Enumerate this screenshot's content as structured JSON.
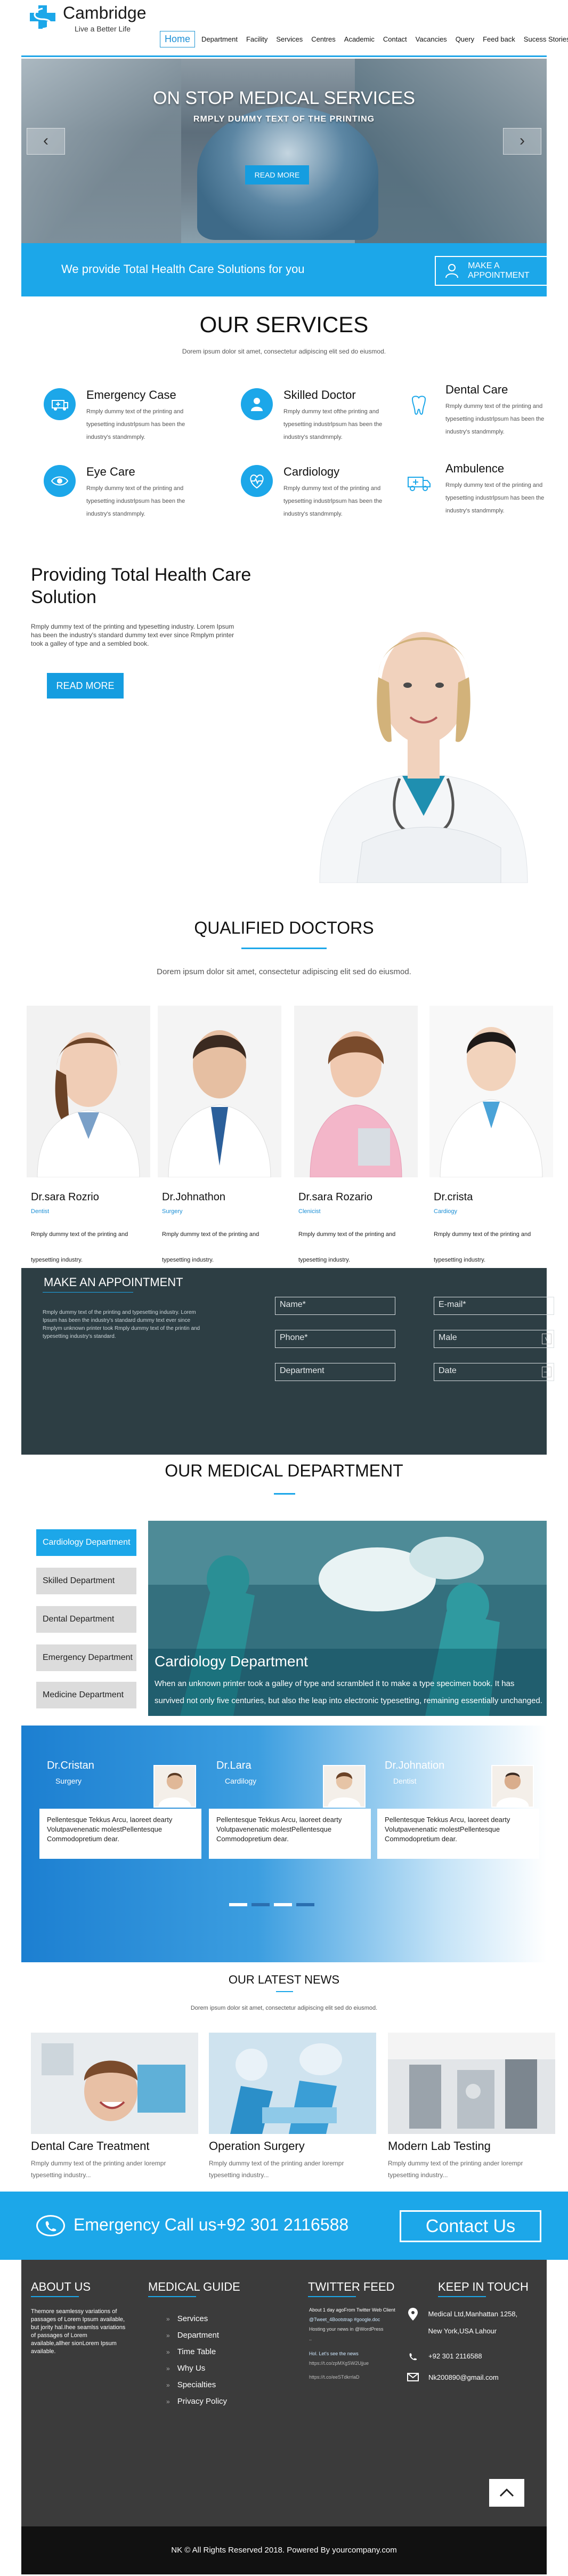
{
  "brand": {
    "name": "Cambridge",
    "tagline": "Live a Better Life",
    "color": "#1ca7e9"
  },
  "nav": [
    "Home",
    "Department",
    "Facility",
    "Services",
    "Centres",
    "Academic",
    "Contact",
    "Vacancies",
    "Query",
    "Feed back",
    "Sucess Stories"
  ],
  "hero": {
    "title": "ON STOP MEDICAL SERVICES",
    "subtitle": "RMPLY DUMMY TEXT OF THE PRINTING",
    "button": "READ MORE",
    "prev_icon": "arrow-left-icon",
    "next_icon": "arrow-right-icon"
  },
  "strip": {
    "text": "We provide Total Health Care Solutions for you",
    "button": "MAKE A APPOINTMENT"
  },
  "services": {
    "title": "OUR SERVICES",
    "subtitle": "Dorem ipsum dolor sit amet, consectetur adipiscing elit sed do eiusmod.",
    "items": [
      {
        "name": "Emergency Case",
        "desc": "Rmply dummy text of the printing and typesetting industrlpsum has been the industry's standmmply.",
        "icon": "ambulance-icon"
      },
      {
        "name": "Skilled Doctor",
        "desc": "Rmply dummy text ofthe printing and typesetting industrlpsum has been the industry's standmmply.",
        "icon": "doctor-icon"
      },
      {
        "name": "Dental Care",
        "desc": "Rmply dummy text of the printing and typesetting industrlpsum has been the industry's standmmply.",
        "icon": "tooth-icon"
      },
      {
        "name": "Eye Care",
        "desc": "Rmply dummy text of the printing and typesetting industrlpsum has been the industry's standmmply.",
        "icon": "eye-icon"
      },
      {
        "name": "Cardiology",
        "desc": "Rmply dummy text of the printing and typesetting industrlpsum has been the industry's standmmply.",
        "icon": "heart-icon"
      },
      {
        "name": "Ambulence",
        "desc": "Rmply dummy text of the printing and typesetting industrlpsum has been the industry's standmmply.",
        "icon": "ambulance-van-icon"
      }
    ]
  },
  "providing": {
    "title": "Providing Total Health Care Solution",
    "text": "Rmply dummy text of the printing and typesetting industry. Lorem Ipsum has been the industry's standard dummy text ever since Rmplym printer took a galley of type and a sembled book.",
    "button": "READ MORE"
  },
  "doctors": {
    "title": "QUALIFIED DOCTORS",
    "subtitle": "Dorem ipsum dolor sit amet, consectetur adipiscing elit sed do eiusmod.",
    "items": [
      {
        "name": "Dr.sara Rozrio",
        "role": "Dentist",
        "desc": "Rmply dummy text of the printing and typesetting industry."
      },
      {
        "name": "Dr.Johnathon",
        "role": "Surgery",
        "desc": "Rmply dummy text of the printing and typesetting industry."
      },
      {
        "name": "Dr.sara Rozario",
        "role": "Clenicist",
        "desc": "Rmply dummy text of the printing and typesetting industry."
      },
      {
        "name": "Dr.crista",
        "role": "Cardiogy",
        "desc": "Rmply dummy text of the printing and typesetting industry."
      }
    ]
  },
  "appointment": {
    "title": "MAKE AN APPOINTMENT",
    "text": "Rmply dummy text of the printing and typesetting industry. Lorem Ipsum has been the industry's standard dummy text ever since Rmplym unknown printer took Rmply dummy text of the printin and typesetting industry's standard.",
    "fields": {
      "name": "Name*",
      "email": "E-mail*",
      "phone": "Phone*",
      "gender": "Male",
      "department": "Department",
      "date": "Date"
    }
  },
  "department": {
    "title": "OUR MEDICAL DEPARTMENT",
    "tabs": [
      "Cardiology Department",
      "Skilled Department",
      "Dental Department",
      "Emergency Department",
      "Medicine Department"
    ],
    "active_title": "Cardiology Department",
    "active_desc": "When an unknown printer took a galley of type and scrambled it to make a type specimen book. It has survived not only five centuries, but also the leap into electronic typesetting, remaining essentially unchanged."
  },
  "testimonials": [
    {
      "name": "Dr.Cristan",
      "role": "Surgery",
      "text": "Pellentesque Tekkus Arcu, laoreet dearty Volutpavenenatic molestPellentesque Commodopretium dear."
    },
    {
      "name": "Dr.Lara",
      "role": "Cardilogy",
      "text": "Pellentesque Tekkus Arcu, laoreet dearty Volutpavenenatic molestPellentesque Commodopretium dear."
    },
    {
      "name": "Dr.Johnation",
      "role": "Dentist",
      "text": "Pellentesque Tekkus Arcu, laoreet dearty Volutpavenenatic molestPellentesque Commodopretium dear."
    }
  ],
  "news": {
    "title": "OUR LATEST NEWS",
    "subtitle": "Dorem ipsum dolor sit amet, consectetur adipiscing elit sed do eiusmod.",
    "items": [
      {
        "title": "Dental Care Treatment",
        "desc": "Rmply dummy text of the printing ander lorempr typesetting industry..."
      },
      {
        "title": "Operation Surgery",
        "desc": "Rmply dummy text of the printing ander lorempr typesetting industry..."
      },
      {
        "title": "Modern Lab Testing",
        "desc": "Rmply dummy text of the printing ander lorempr typesetting industry..."
      }
    ]
  },
  "emergency": {
    "text": "Emergency Call us+92 301 2116588",
    "button": "Contact Us"
  },
  "footer": {
    "about_title": "ABOUT US",
    "about_text": "Themore seamlessy variations of passages of Lorem Ipsum available, but jority hal.Ihee seamlss variations of passages of Lorem available,allher sionLorem Ipsum available.",
    "guide_title": "MEDICAL GUIDE",
    "guide_links": [
      "Services",
      "Department",
      "Time Table",
      "Why Us",
      "Specialties",
      "Privacy Policy"
    ],
    "twitter_title": "TWITTER FEED",
    "tweets": [
      "About 1 day agoFrom Twitter Web Client",
      "@Tweet_4Bootstrap #google.doc",
      "Hosting your news in @WordPress",
      "..",
      "Hol. Let's see the news",
      "https://t.co/zpMXgSW2Ujjue",
      "https://t.co/eeSTdkrrlaD"
    ],
    "keep_title": "KEEP IN TOUCH",
    "address": "Medical Ltd,Manhattan 1258, New York,USA Lahour",
    "phone": "+92 301 2116588",
    "email": "Nk200890@gmail.com"
  },
  "copyright": "NK © All Rights Reserved 2018. Powered By yourcompany.com"
}
